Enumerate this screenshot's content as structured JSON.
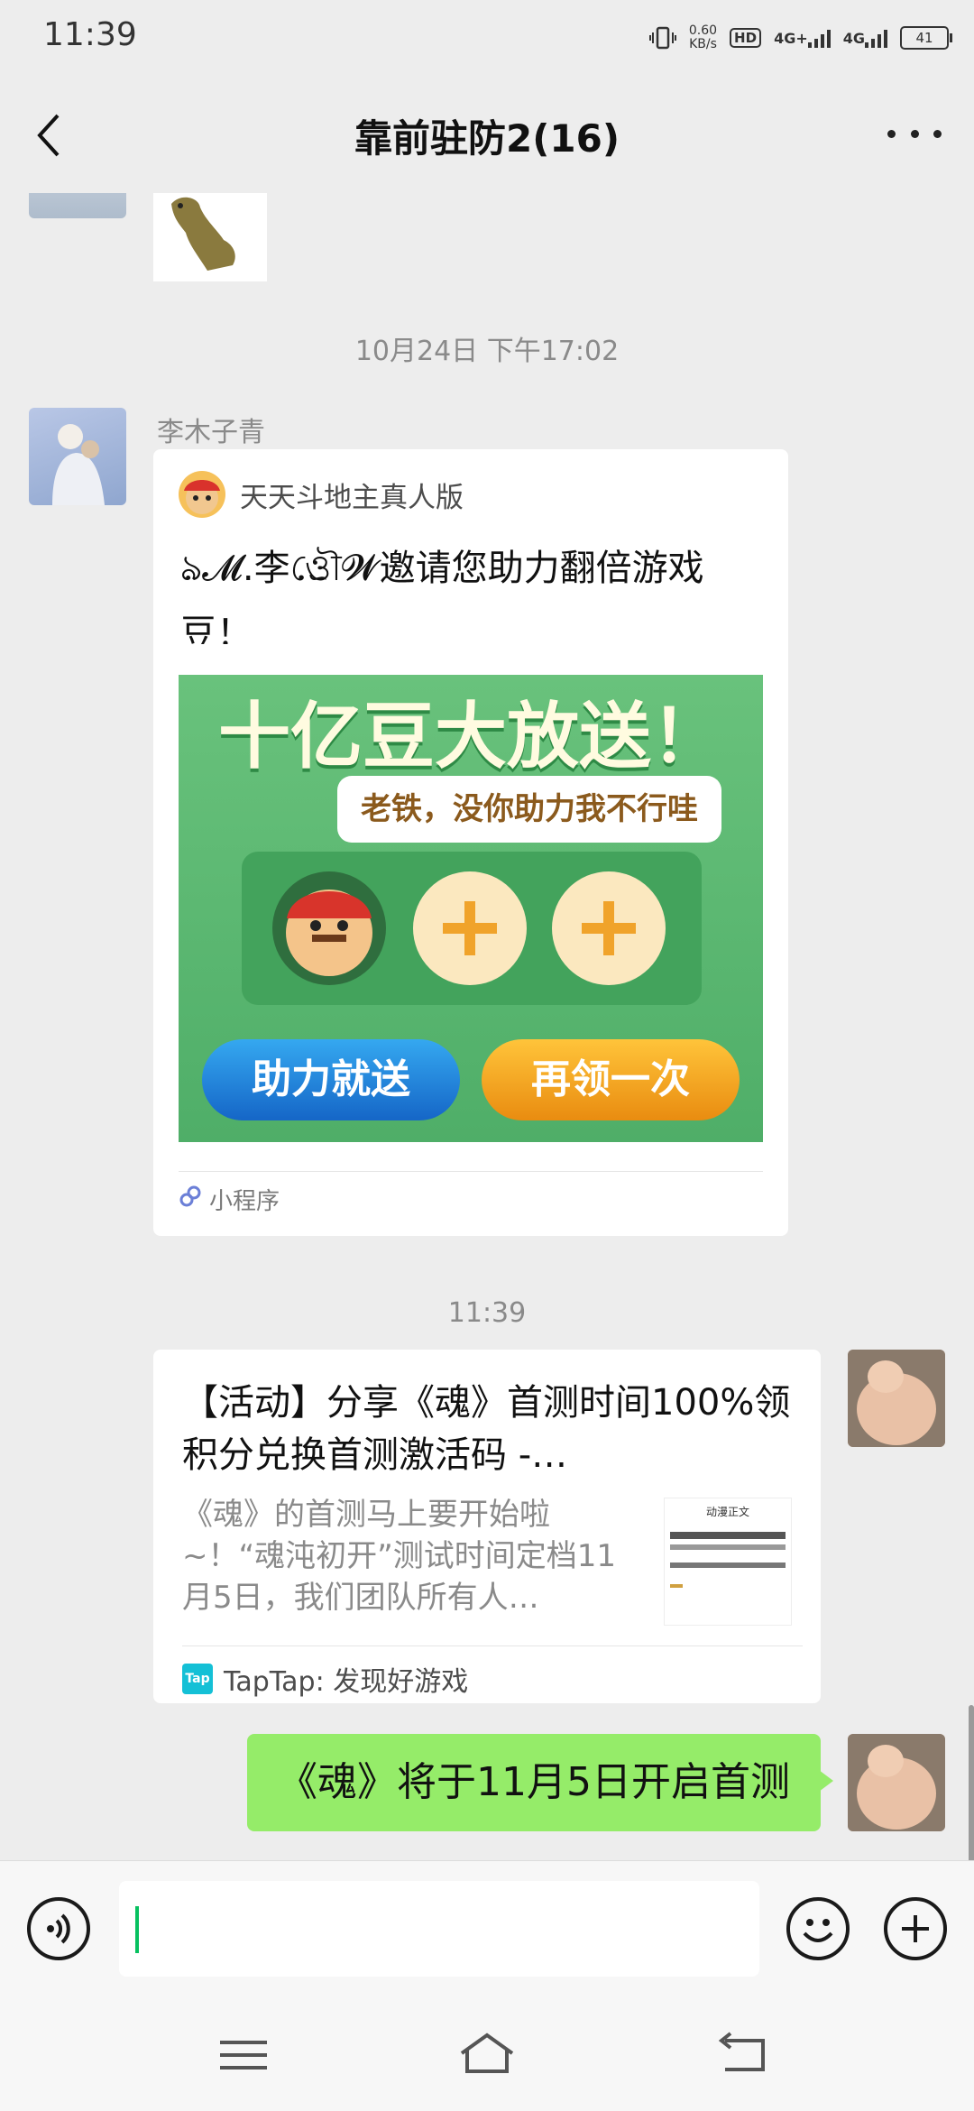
{
  "status_bar": {
    "time": "11:39",
    "net_speed": "0.60",
    "net_speed_unit": "KB/s",
    "hd_label": "HD",
    "sim1_label": "4G+",
    "sim2_label": "4G",
    "battery": "41"
  },
  "header": {
    "title": "靠前驻防2(16)",
    "back_icon": "chevron-left-icon",
    "more_icon": "more-dots-icon"
  },
  "chat": {
    "timestamp1": "10月24日 下午17:02",
    "message1": {
      "sender": "李木子青",
      "type": "mini-program",
      "app_name": "天天斗地主真人版",
      "description": "ঌ𝓜.李ও্রৌ𝓦邀请您助力翻倍游戏豆！",
      "banner_title": "十亿豆大放送！",
      "banner_bubble": "老铁，没你助力我不行哇",
      "banner_btn_left": "助力就送",
      "banner_btn_right": "再领一次",
      "footer": "小程序"
    },
    "timestamp2": "11:39",
    "message2": {
      "type": "link",
      "title": "【活动】分享《魂》首测时间100%领积分兑换首测激活码 -…",
      "desc": "《魂》的首测马上要开始啦~！“魂沌初开”测试时间定档11月5日，我们团队所有人…",
      "thumb_caption": "动漫正文",
      "source": "TapTap: 发现好游戏"
    },
    "message3": {
      "type": "text",
      "text": "《魂》将于11月5日开启首测"
    }
  },
  "input_bar": {
    "voice_icon": "voice-icon",
    "emoji_icon": "emoji-icon",
    "plus_icon": "plus-icon"
  },
  "nav_bar": {
    "menu_icon": "menu-icon",
    "home_icon": "home-icon",
    "back_icon": "back-icon"
  }
}
